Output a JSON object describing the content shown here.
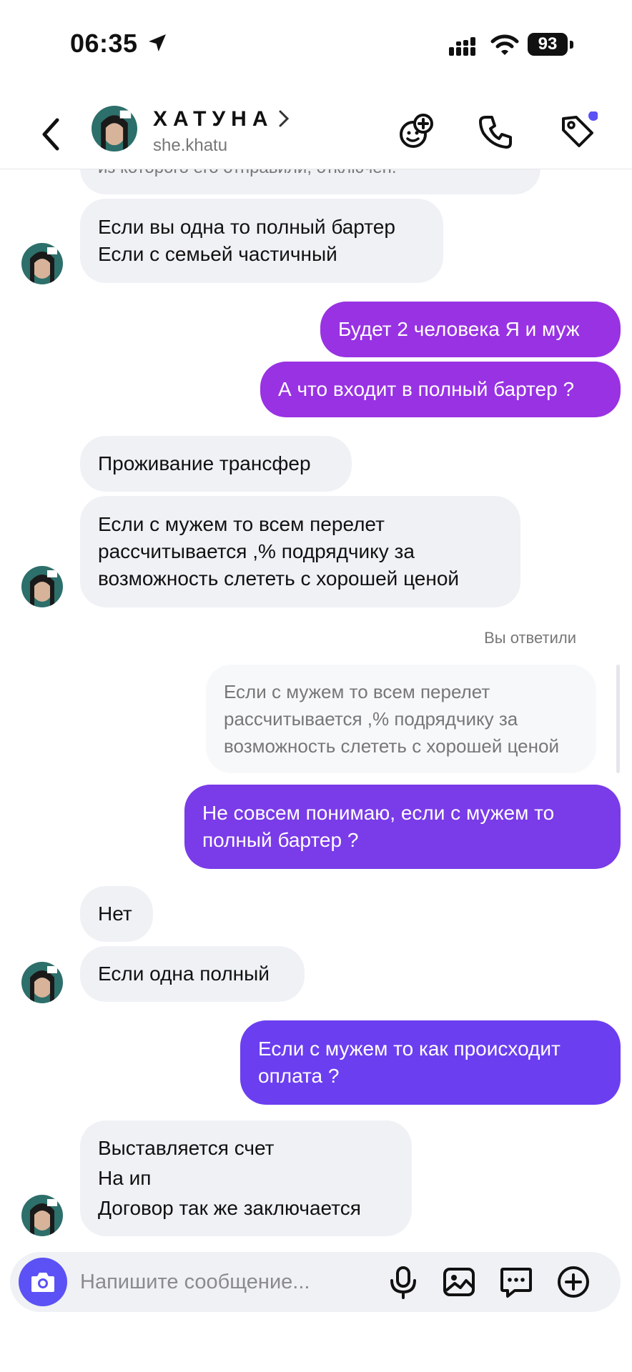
{
  "status_bar": {
    "time": "06:35",
    "battery": "93"
  },
  "header": {
    "name": "ХАТУНА",
    "username": "she.khatu"
  },
  "messages": {
    "m0": "из которого его отправили, отключен.",
    "m1": [
      "Если вы одна то полный бартер",
      "Если с семьей частичный"
    ],
    "m2": "Будет 2 человека Я и муж",
    "m3": "А что входит в полный бартер ?",
    "m4": "Проживание трансфер",
    "m5": [
      "Если с мужем то всем перелет",
      "рассчитывается ,% подрядчику за",
      "возможность слететь с хорошей ценой"
    ],
    "replied_label": "Вы ответили",
    "quoted": [
      "Если с мужем то всем перелет",
      "рассчитывается ,% подрядчику за",
      "возможность слететь с хорошей ценой"
    ],
    "m6": [
      "Не совсем понимаю, если с мужем то",
      "полный бартер ?"
    ],
    "m7": "Нет",
    "m8": "Если одна полный",
    "m9": [
      "Если с мужем то как происходит",
      "оплата ?"
    ],
    "m10": [
      "Выставляется счет",
      "На ип",
      "Договор так же заключается"
    ]
  },
  "composer": {
    "placeholder": "Напишите сообщение..."
  },
  "colors": {
    "accent": "#5b51f5",
    "outgoing_1": "#9832e3",
    "outgoing_2": "#7a3be8",
    "outgoing_3": "#6b3ef0",
    "incoming": "#eff1f5",
    "unread_dot": "#5b51f5"
  },
  "icons": [
    "location-arrow-icon",
    "signal-icon",
    "wifi-icon",
    "battery-icon",
    "back-chevron-icon",
    "chevron-right-icon",
    "add-effect-icon",
    "phone-icon",
    "tag-icon",
    "camera-icon",
    "microphone-icon",
    "gallery-icon",
    "sticker-icon",
    "plus-icon"
  ]
}
